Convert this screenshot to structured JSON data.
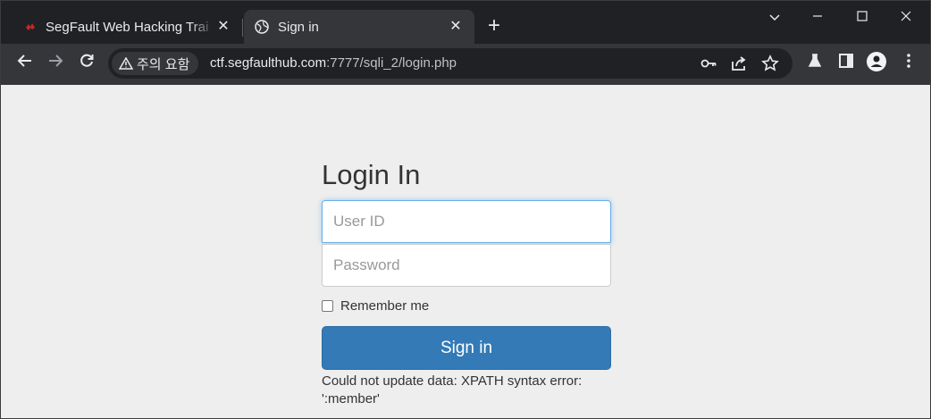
{
  "tabs": [
    {
      "title": "SegFault Web Hacking Trai",
      "close": "✕"
    },
    {
      "title": "Sign in",
      "close": "✕"
    }
  ],
  "new_tab": "+",
  "window_controls": {
    "dropdown": "⌄",
    "minimize": "—",
    "maximize": "☐",
    "close": "✕"
  },
  "toolbar": {
    "back": "←",
    "forward": "→",
    "reload": "↻",
    "security_label": "주의 요함",
    "url_host": "ctf.segfaulthub.com",
    "url_path": ":7777/sqli_2/login.php",
    "icons": [
      "key-icon",
      "share-icon",
      "star-icon",
      "labs-icon",
      "sidepanel-icon",
      "profile-icon",
      "menu-icon"
    ]
  },
  "login": {
    "heading": "Login In",
    "user_id_placeholder": "User ID",
    "password_placeholder": "Password",
    "remember_label": "Remember me",
    "signin_label": "Sign in",
    "error_text": "Could not update data: XPATH syntax error: ':member'"
  },
  "colors": {
    "button": "#337ab7",
    "page_bg": "#eeeeee",
    "chrome_dark": "#202124",
    "chrome_toolbar": "#35363a"
  }
}
